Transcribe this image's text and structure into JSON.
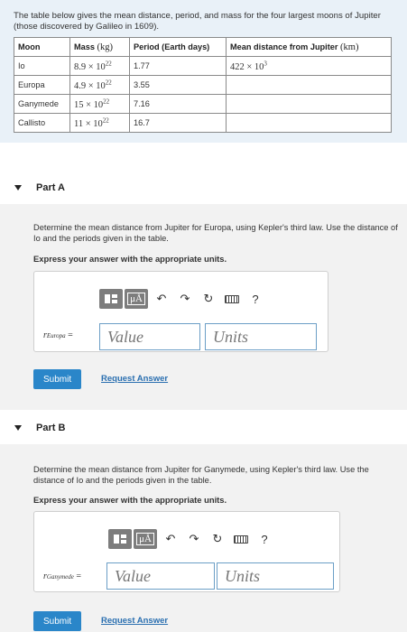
{
  "intro": {
    "text": "The table below gives the mean distance, period, and mass for the four largest moons of Jupiter (those discovered by Galileo in 1609)."
  },
  "table": {
    "headers": {
      "moon": "Moon",
      "mass": "Mass",
      "mass_unit": "(kg)",
      "period": "Period (Earth days)",
      "distance": "Mean distance from Jupiter",
      "distance_unit": "(km)"
    },
    "rows": [
      {
        "moon": "Io",
        "mass_base": "8.9 × 10",
        "mass_exp": "22",
        "period": "1.77",
        "dist_base": "422 × 10",
        "dist_exp": "3"
      },
      {
        "moon": "Europa",
        "mass_base": "4.9 × 10",
        "mass_exp": "22",
        "period": "3.55",
        "dist_base": "",
        "dist_exp": ""
      },
      {
        "moon": "Ganymede",
        "mass_base": "15 × 10",
        "mass_exp": "22",
        "period": "7.16",
        "dist_base": "",
        "dist_exp": ""
      },
      {
        "moon": "Callisto",
        "mass_base": "11 × 10",
        "mass_exp": "22",
        "period": "16.7",
        "dist_base": "",
        "dist_exp": ""
      }
    ]
  },
  "partA": {
    "title": "Part A",
    "question": "Determine the mean distance from Jupiter for Europa, using Kepler's third law. Use the distance of Io and the periods given in the table.",
    "express": "Express your answer with the appropriate units.",
    "var": "r",
    "var_sub": "Europa",
    "equals": "=",
    "value_placeholder": "Value",
    "units_placeholder": "Units",
    "submit": "Submit",
    "request": "Request Answer"
  },
  "partB": {
    "title": "Part B",
    "question": "Determine the mean distance from Jupiter for Ganymede, using Kepler's third law. Use the distance of Io and the periods given in the table.",
    "express": "Express your answer with the appropriate units.",
    "var": "r",
    "var_sub": "Ganymede",
    "equals": "=",
    "value_placeholder": "Value",
    "units_placeholder": "Units",
    "submit": "Submit",
    "request": "Request Answer"
  },
  "toolbar": {
    "mu_label": "μÅ",
    "help": "?",
    "icons": [
      "template-icon",
      "units-mu-icon",
      "undo-icon",
      "redo-icon",
      "reset-icon",
      "keyboard-icon",
      "help-icon"
    ]
  },
  "colors": {
    "intro_bg": "#e9f1f8",
    "part_bg": "#f2f2f2",
    "submit_bg": "#2a86c9",
    "link": "#2a6fb0",
    "input_border": "#6b9ec6"
  }
}
